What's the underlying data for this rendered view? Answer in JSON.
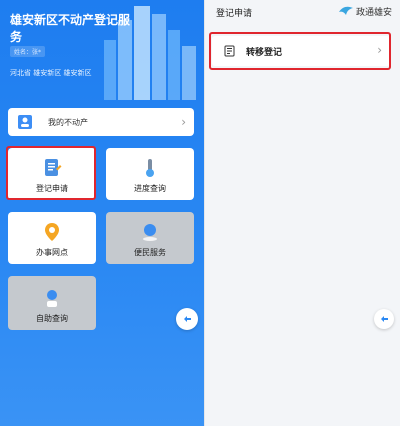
{
  "left_panel": {
    "title": "雄安新区不动产登记服务",
    "subtitle": "姓名：张*",
    "region": "河北省 雄安新区 雄安新区",
    "property_bar_label": "我的不动产",
    "tiles": [
      {
        "label": "登记申请",
        "icon": "registration-icon",
        "highlighted": true
      },
      {
        "label": "进度查询",
        "icon": "progress-icon"
      },
      {
        "label": "办事网点",
        "icon": "location-pin-icon"
      },
      {
        "label": "便民服务",
        "icon": "service-globe-icon"
      },
      {
        "label": "自助查询",
        "icon": "self-query-icon"
      }
    ]
  },
  "right_panel": {
    "header_title": "登记申请",
    "brand_name": "政通雄安",
    "items": [
      {
        "label": "转移登记",
        "icon": "document-icon",
        "highlighted": true
      }
    ]
  },
  "colors": {
    "accent_blue": "#1e7df0",
    "highlight_red": "#e0262e"
  }
}
